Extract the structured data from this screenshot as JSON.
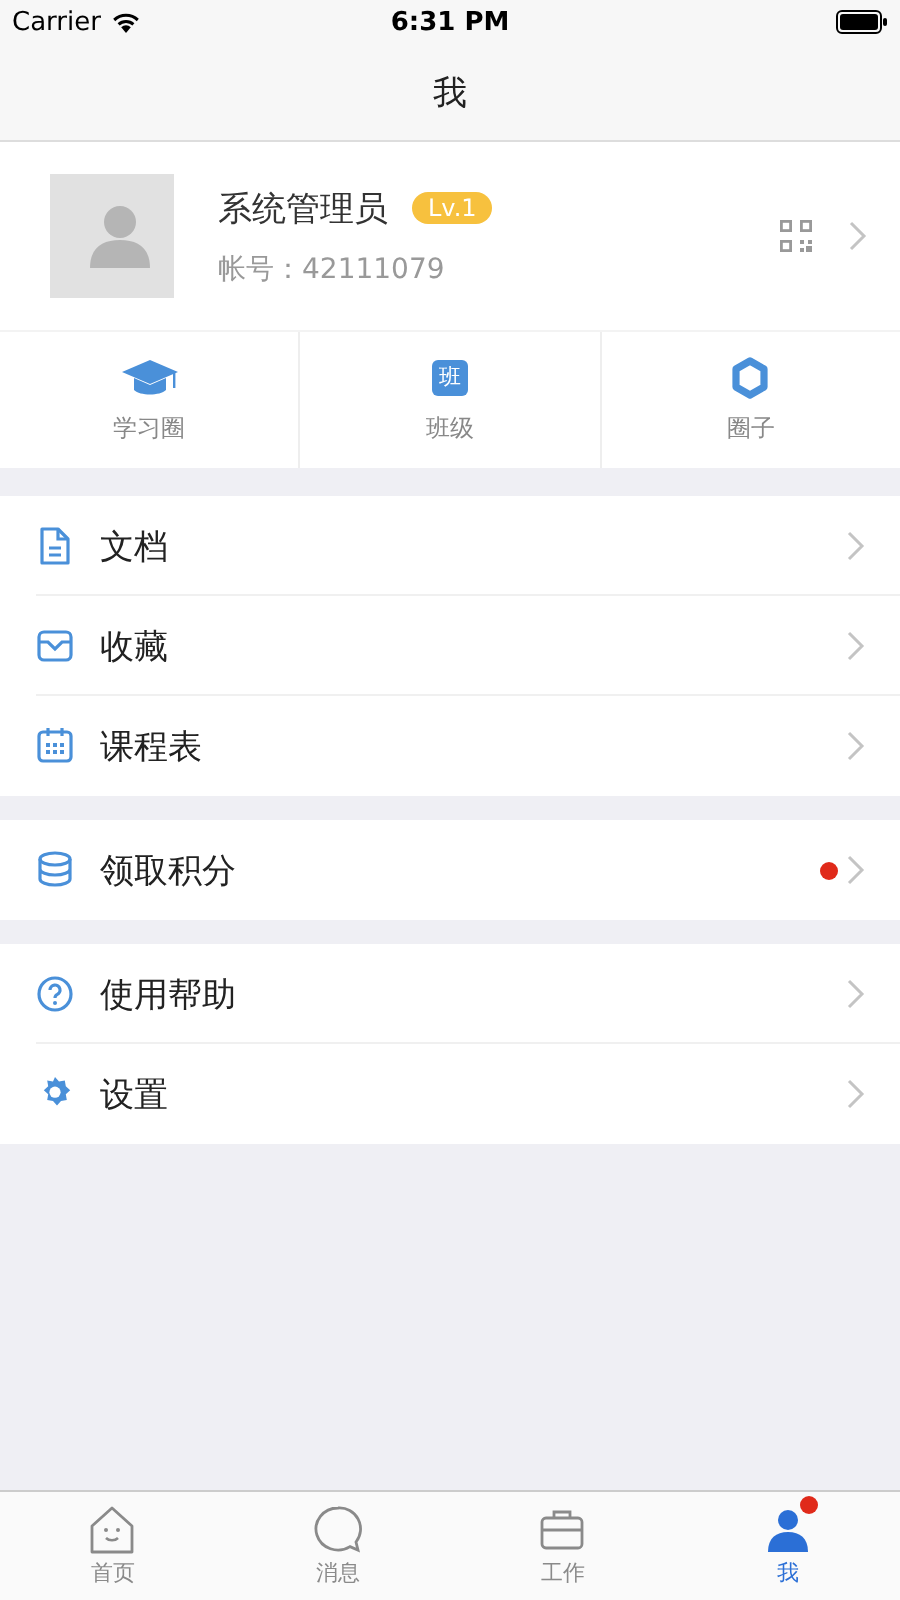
{
  "status_bar": {
    "carrier": "Carrier",
    "time": "6:31 PM"
  },
  "nav_bar": {
    "title": "我"
  },
  "profile": {
    "name": "系统管理员",
    "level_badge": "Lv.1",
    "account": "帐号：42111079"
  },
  "shortcuts": [
    {
      "label": "学习圈"
    },
    {
      "label": "班级",
      "glyph": "班"
    },
    {
      "label": "圈子"
    }
  ],
  "menu_groups": [
    {
      "items": [
        {
          "label": "文档",
          "dot": false
        },
        {
          "label": "收藏",
          "dot": false
        },
        {
          "label": "课程表",
          "dot": false
        }
      ]
    },
    {
      "items": [
        {
          "label": "领取积分",
          "dot": true
        }
      ]
    },
    {
      "items": [
        {
          "label": "使用帮助",
          "dot": false
        },
        {
          "label": "设置",
          "dot": false
        }
      ]
    }
  ],
  "tab_bar": [
    {
      "label": "首页",
      "selected": false,
      "dot": false
    },
    {
      "label": "消息",
      "selected": false,
      "dot": false
    },
    {
      "label": "工作",
      "selected": false,
      "dot": false
    },
    {
      "label": "我",
      "selected": true,
      "dot": true
    }
  ]
}
